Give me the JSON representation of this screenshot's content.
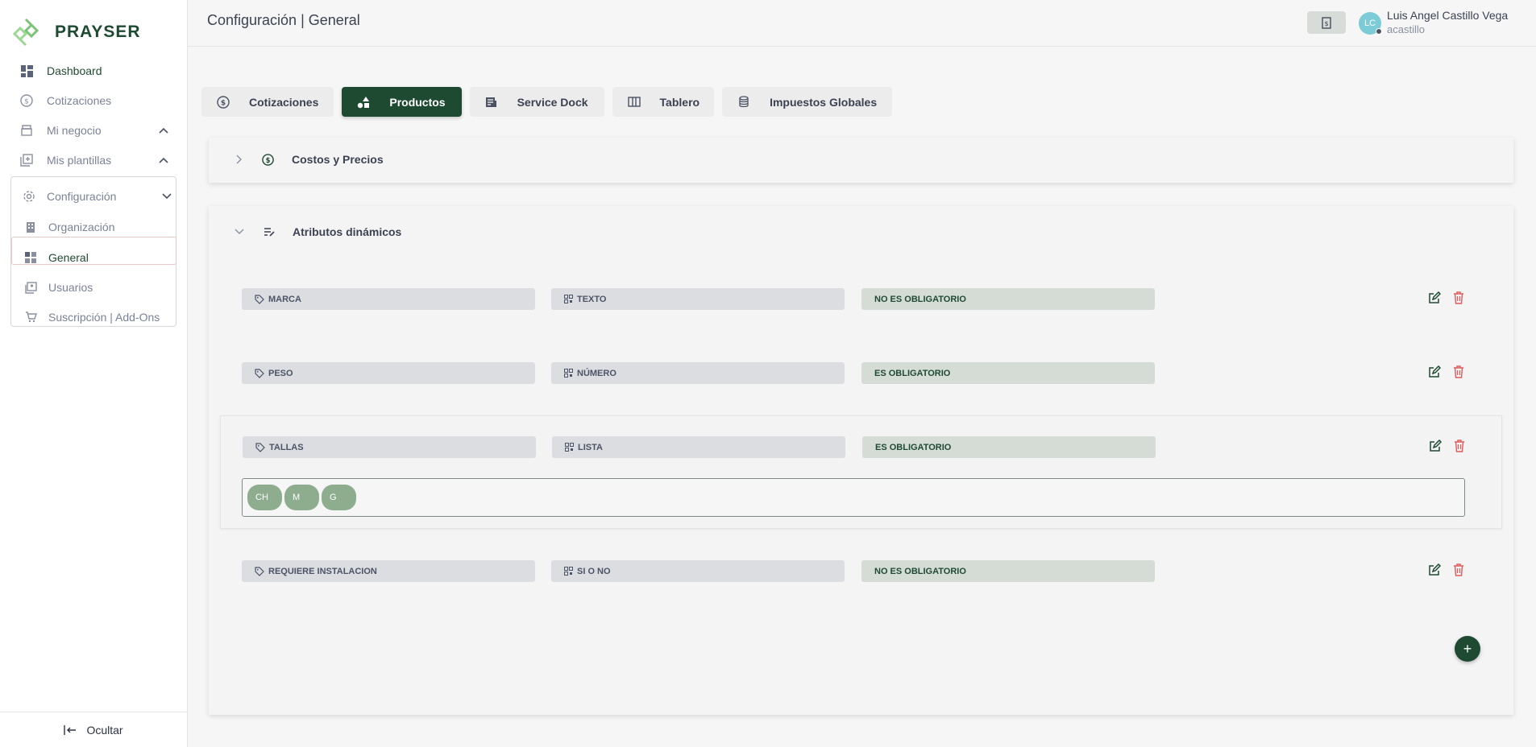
{
  "brand": {
    "name": "PRAYSER"
  },
  "sidebar": {
    "items": [
      {
        "label": "Dashboard"
      },
      {
        "label": "Cotizaciones"
      },
      {
        "label": "Mi negocio"
      },
      {
        "label": "Mis plantillas"
      },
      {
        "label": "Configuración"
      }
    ],
    "config_items": [
      {
        "label": "Organización"
      },
      {
        "label": "General"
      },
      {
        "label": "Usuarios"
      },
      {
        "label": "Suscripción | Add-Ons"
      }
    ],
    "hide_label": "Ocultar"
  },
  "header": {
    "title": "Configuración | General",
    "user": {
      "initials": "LC",
      "name": "Luis Angel Castillo Vega",
      "handle": "acastillo"
    }
  },
  "tabs": [
    {
      "label": "Cotizaciones",
      "icon": "dollar-circle-icon"
    },
    {
      "label": "Productos",
      "icon": "shapes-icon",
      "active": true
    },
    {
      "label": "Service Dock",
      "icon": "document-icon"
    },
    {
      "label": "Tablero",
      "icon": "columns-icon"
    },
    {
      "label": "Impuestos Globales",
      "icon": "database-icon"
    }
  ],
  "panels": {
    "costos": {
      "title": "Costos y Precios"
    },
    "atributos": {
      "title": "Atributos dinámicos"
    }
  },
  "attributes": [
    {
      "name": "MARCA",
      "type": "TEXTO",
      "required": "NO ES OBLIGATORIO"
    },
    {
      "name": "PESO",
      "type": "NÚMERO",
      "required": "ES OBLIGATORIO"
    },
    {
      "name": "TALLAS",
      "type": "LISTA",
      "required": "ES OBLIGATORIO",
      "values": [
        "CH",
        "M",
        "G"
      ]
    },
    {
      "name": "REQUIERE INSTALACION",
      "type": "SI O NO",
      "required": "NO ES OBLIGATORIO"
    }
  ],
  "add_label": "+",
  "colors": {
    "primary": "#1e4a32",
    "danger": "#e05a5a",
    "pill": "#8ead8f"
  }
}
